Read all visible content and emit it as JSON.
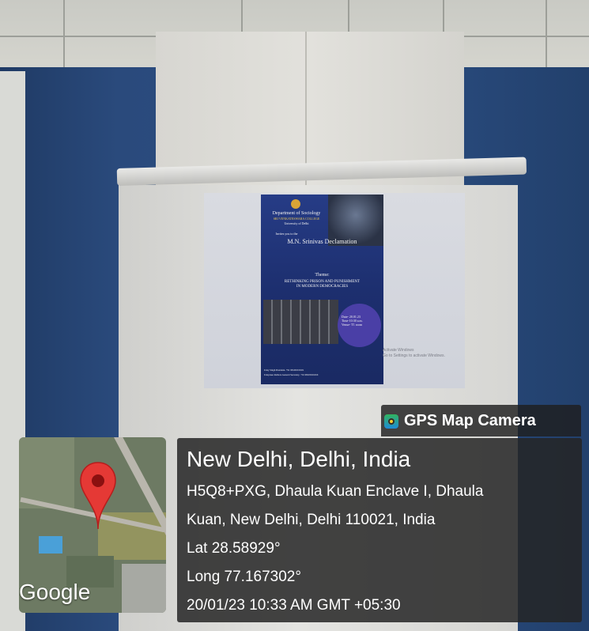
{
  "poster": {
    "department": "Department of Sociology",
    "college": "SRI VENKATESWARA COLLEGE",
    "university": "University of Delhi",
    "invitation": "Invites you to the",
    "event": "M.N. Srinivas Declamation",
    "theme_label": "Theme:",
    "theme_line1": "RETHINKING PRISON AND PUNISHMENT",
    "theme_line2": "IN MODERN DEMOCRACIES",
    "date": "Date- 20.01.23",
    "time": "Time-10:30 a.m.",
    "venue": "Venue- T1 room",
    "footer_line1": "Uday Singh President- +91 9810XXXXX",
    "footer_line2": "Udayanee Rathore General Secretary- +91 9810XXXXX"
  },
  "watermark": {
    "line1": "Activate Windows",
    "line2": "Go to Settings to activate Windows."
  },
  "overlay": {
    "app_name": "GPS Map Camera",
    "map_provider": "Google",
    "location_title": "New Delhi, Delhi, India",
    "address_line1": "H5Q8+PXG, Dhaula Kuan Enclave I, Dhaula",
    "address_line2": "Kuan, New Delhi, Delhi 110021, India",
    "latitude": "Lat 28.58929°",
    "longitude": "Long 77.167302°",
    "timestamp": "20/01/23 10:33 AM GMT +05:30"
  },
  "colors": {
    "wall": "#2a4a7c",
    "overlay_bg": "#242424",
    "pin": "#e53935",
    "poster_bg": "#1d2f6f"
  },
  "icons": [
    "gps-map-camera-app-icon",
    "map-pin-icon"
  ]
}
